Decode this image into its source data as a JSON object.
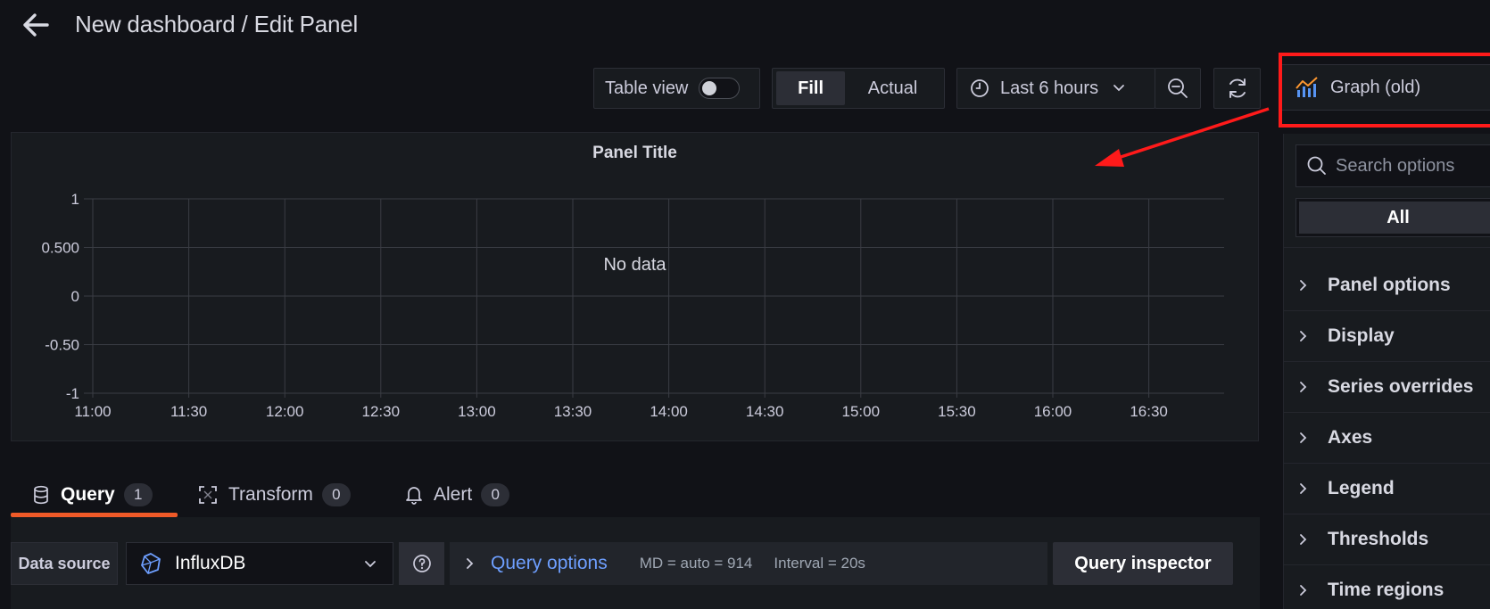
{
  "header": {
    "breadcrumb": "New dashboard / Edit Panel"
  },
  "toolbar": {
    "table_view_label": "Table view",
    "table_view_on": false,
    "fill_label": "Fill",
    "actual_label": "Actual",
    "time_range": "Last 6 hours",
    "visualization": "Graph (old)"
  },
  "panel": {
    "title": "Panel Title",
    "no_data": "No data"
  },
  "chart_data": {
    "type": "line",
    "title": "Panel Title",
    "x_ticks": [
      "11:00",
      "11:30",
      "12:00",
      "12:30",
      "13:00",
      "13:30",
      "14:00",
      "14:30",
      "15:00",
      "15:30",
      "16:00",
      "16:30"
    ],
    "y_ticks": [
      "1",
      "0.500",
      "0",
      "-0.50",
      "-1"
    ],
    "ylim": [
      -1,
      1
    ],
    "series": [],
    "grid": true,
    "annotation": "No data"
  },
  "tabs": [
    {
      "label": "Query",
      "count": "1",
      "active": true
    },
    {
      "label": "Transform",
      "count": "0",
      "active": false
    },
    {
      "label": "Alert",
      "count": "0",
      "active": false
    }
  ],
  "query_row": {
    "data_source_label": "Data source",
    "data_source": "InfluxDB",
    "query_options_label": "Query options",
    "md": "MD = auto = 914",
    "interval": "Interval = 20s",
    "query_inspector": "Query inspector"
  },
  "options": {
    "search_placeholder": "Search options",
    "filter_all": "All",
    "sections": [
      "Panel options",
      "Display",
      "Series overrides",
      "Axes",
      "Legend",
      "Thresholds",
      "Time regions"
    ]
  },
  "colors": {
    "accent_tab": "#f05a28",
    "link": "#6e9fff",
    "highlight": "#ff1a1a"
  }
}
